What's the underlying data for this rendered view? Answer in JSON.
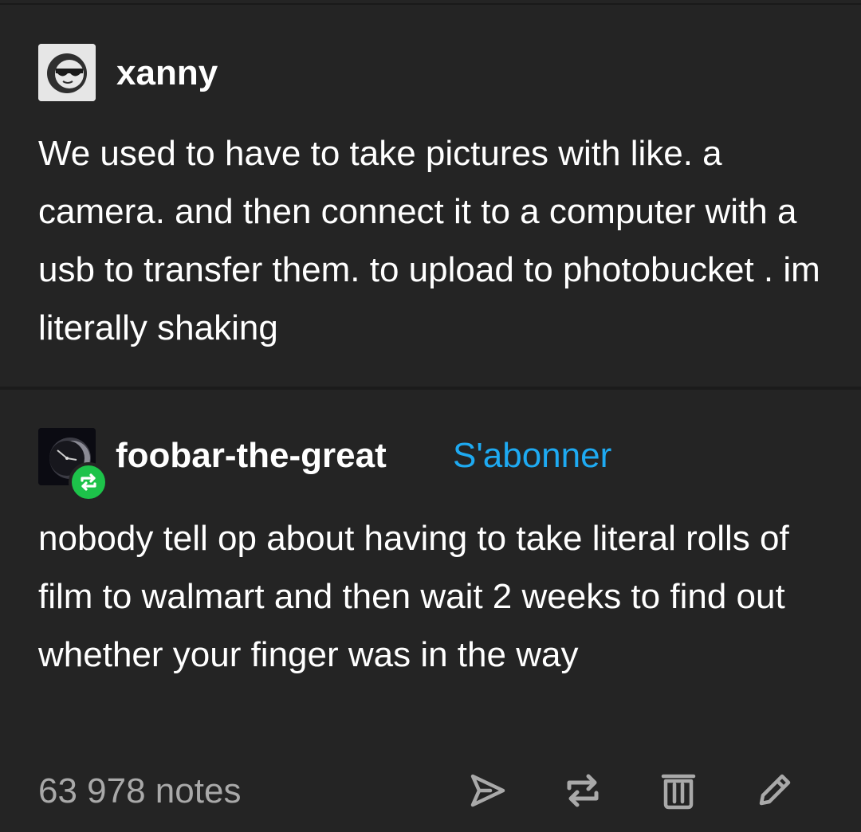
{
  "posts": [
    {
      "username": "xanny",
      "avatar": "sunglasses-face-avatar",
      "text": "We used to have to take pictures with like. a camera. and then connect it to a computer with a usb to transfer them. to upload to photobucket . im literally shaking"
    },
    {
      "username": "foobar-the-great",
      "avatar": "dark-clock-avatar",
      "badge": "reblog-icon",
      "follow_label": "S'abonner",
      "text": "nobody tell op about having to take literal rolls of film to walmart and then wait 2 weeks to find out whether your finger was in the way"
    }
  ],
  "footer": {
    "notes": "63 978 notes",
    "actions": [
      "share-icon",
      "reblog-icon",
      "delete-icon",
      "edit-icon"
    ]
  },
  "colors": {
    "background": "#242424",
    "text": "#ffffff",
    "muted": "#a9a9a9",
    "link": "#1eaaf2",
    "reblog_badge": "#1dc34a"
  }
}
